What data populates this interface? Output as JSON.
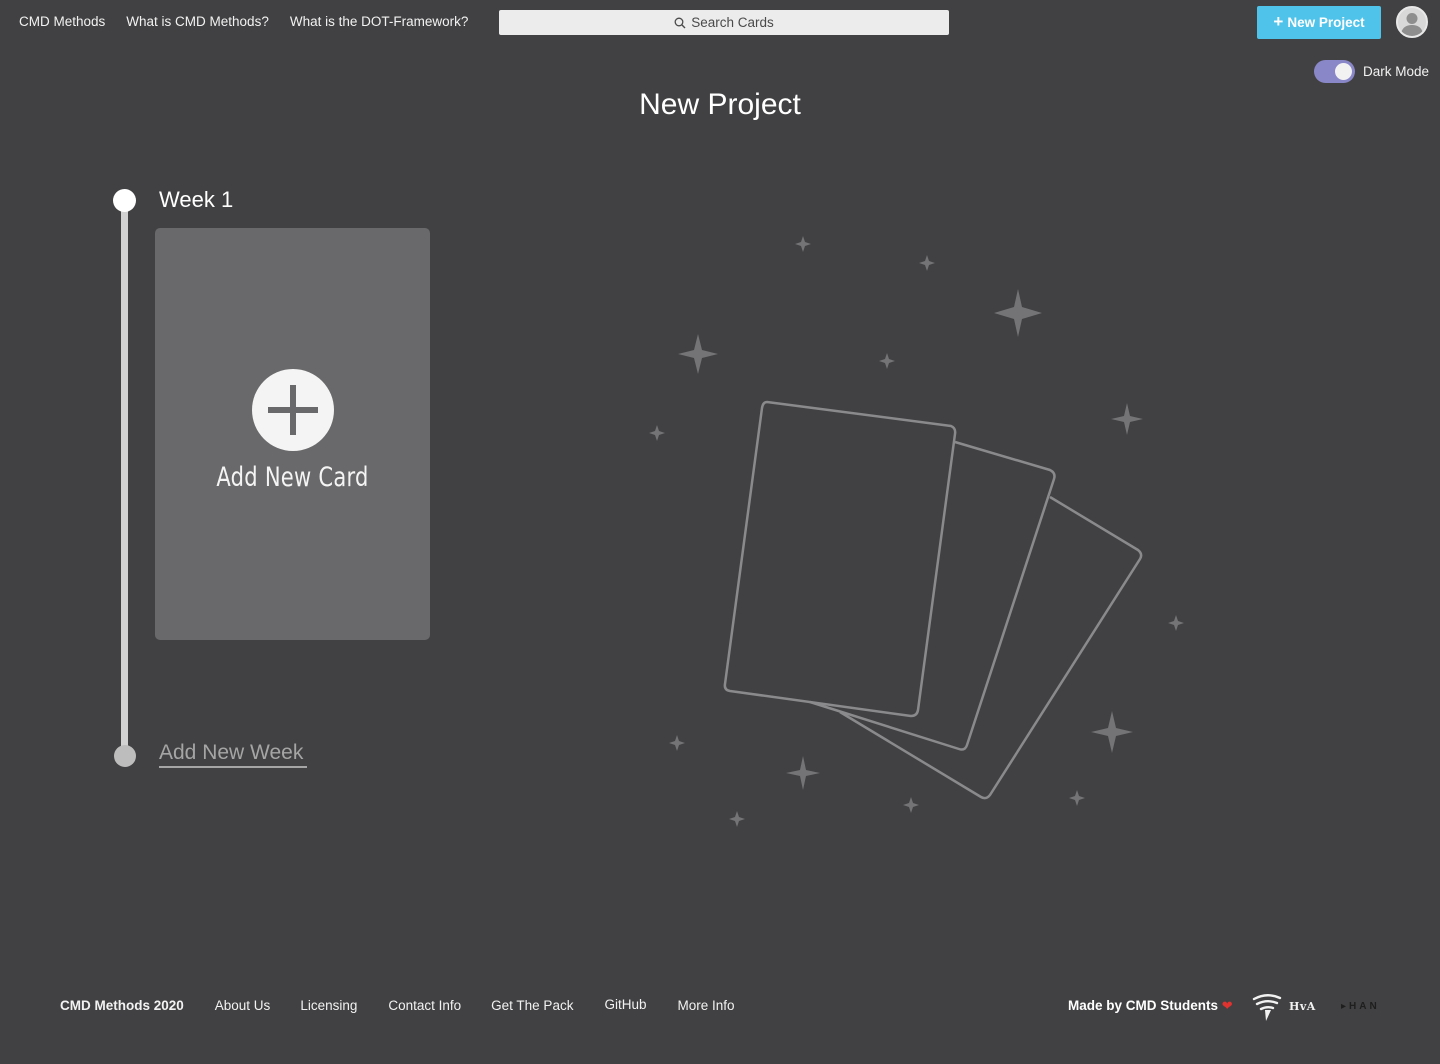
{
  "header": {
    "nav": [
      "CMD Methods",
      "What is CMD Methods?",
      "What is the DOT-Framework?"
    ],
    "search_placeholder": "Search Cards",
    "new_project_label": "New Project",
    "dark_mode_label": "Dark Mode",
    "dark_mode_on": true
  },
  "page": {
    "title": "New Project",
    "week_title": "Week 1",
    "add_card_label": "Add New Card",
    "add_week_label": "Add New Week"
  },
  "footer": {
    "brand": "CMD Methods 2020",
    "links": [
      "About Us",
      "Licensing",
      "Contact Info",
      "Get The Pack",
      "GitHub",
      "More Info"
    ],
    "made_by": "Made by CMD Students",
    "logos": [
      "HvA",
      "HAN"
    ]
  },
  "colors": {
    "background": "#414143",
    "accent": "#4fc3ea",
    "toggle": "#8a87c8",
    "card": "#69696b"
  }
}
